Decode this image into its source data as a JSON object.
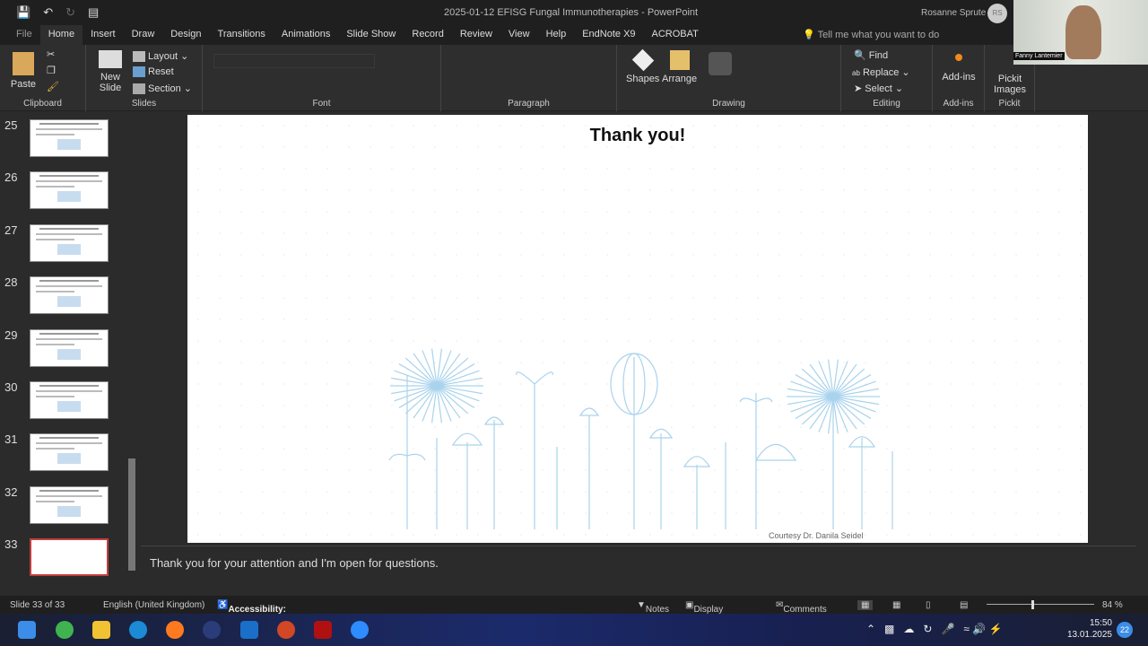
{
  "window": {
    "title": "2025-01-12 EFISG Fungal Immunotherapies  -  PowerPoint",
    "user": "Rosanne Sprute",
    "user_initials": "RS"
  },
  "tabs": [
    "File",
    "Home",
    "Insert",
    "Draw",
    "Design",
    "Transitions",
    "Animations",
    "Slide Show",
    "Record",
    "Review",
    "View",
    "Help",
    "EndNote X9",
    "ACROBAT"
  ],
  "tell_me": "Tell me what you want to do",
  "ribbon": {
    "paste": "Paste",
    "new_slide": "New Slide",
    "layout": "Layout",
    "reset": "Reset",
    "section": "Section",
    "shapes": "Shapes",
    "arrange": "Arrange",
    "find": "Find",
    "replace": "Replace",
    "select": "Select",
    "addins": "Add-ins",
    "pickit": "Pickit Images",
    "groups": {
      "clipboard": "Clipboard",
      "slides": "Slides",
      "font": "Font",
      "paragraph": "Paragraph",
      "drawing": "Drawing",
      "editing": "Editing",
      "addins": "Add-ins",
      "pickit": "Pickit"
    }
  },
  "video": {
    "name": "Fanny Lantemier"
  },
  "thumbnails": [
    "25",
    "26",
    "27",
    "28",
    "29",
    "30",
    "31",
    "32",
    "33"
  ],
  "slide": {
    "title": "Thank you!",
    "credit": "Courtesy Dr. Danila Seidel"
  },
  "notes": "Thank you for your attention and I'm open for questions.",
  "status": {
    "slide": "Slide 33 of 33",
    "language": "English (United Kingdom)",
    "accessibility": "Accessibility: Investigate",
    "notes": "Notes",
    "display": "Display Settings",
    "comments": "Comments",
    "zoom": "84 %"
  },
  "clock": {
    "time": "15:50",
    "date": "13.01.2025",
    "badge": "22"
  },
  "colors": {
    "accent": "#c43e3e",
    "illustration": "#a9d3ec"
  }
}
